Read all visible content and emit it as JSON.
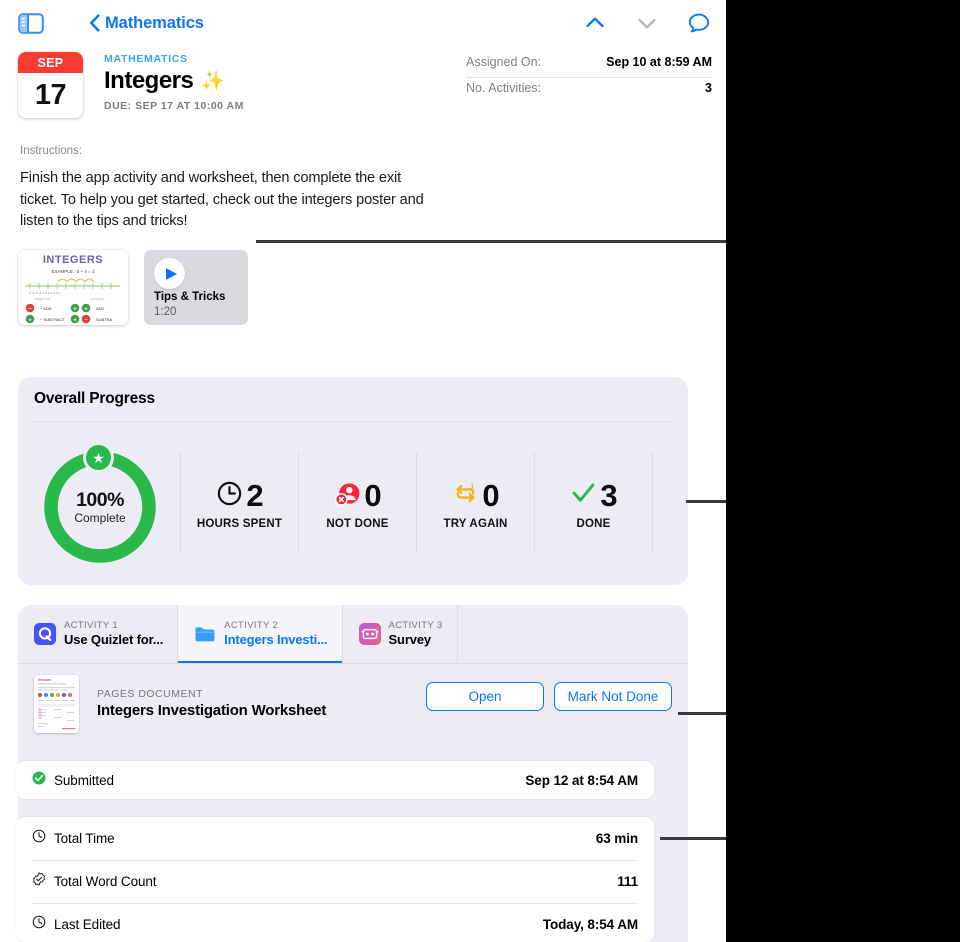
{
  "navbar": {
    "sidebar_toggle_icon": "sidebar-toggle-icon",
    "back_label": "Mathematics",
    "icons": [
      "chevron-up-icon",
      "chevron-down-icon",
      "comment-bubble-icon"
    ],
    "accent_color": "#0a76f6",
    "chevron_up_color": "#0a76f6",
    "chevron_down_color": "#b4b4bb"
  },
  "assignment": {
    "calendar": {
      "month": "SEP",
      "day": "17",
      "month_bg": "#fa3b32"
    },
    "course": "MATHEMATICS",
    "title": "Integers",
    "title_emoji": "✨",
    "due": "DUE: SEP 17 AT 10:00 AM"
  },
  "meta": {
    "rows": [
      {
        "key": "Assigned On:",
        "value": "Sep 10 at 8:59 AM"
      },
      {
        "key": "No. Activities:",
        "value": "3"
      }
    ]
  },
  "instructions": {
    "label": "Instructions:",
    "body": "Finish the app activity and worksheet, then complete the exit ticket. To help you get started, check out the integers poster and listen to the tips and tricks!"
  },
  "attachments": [
    {
      "kind": "image-poster",
      "icon": "integers-poster-thumbnail",
      "heading": "INTEGERS",
      "subheading": "EXAMPLE: -3 + 4 = 1",
      "left_label": "negative",
      "right_label": "positive",
      "rules": [
        "- ADD",
        "+ ADD",
        "+ SUBTRACT",
        "- SUBTRACT"
      ]
    },
    {
      "kind": "audio",
      "icon": "play-icon",
      "title": "Tips & Tricks",
      "duration": "1:20"
    }
  ],
  "progress_card": {
    "title": "Overall Progress",
    "background": "#edecf5",
    "ring": {
      "percent": 100,
      "percent_label": "100%",
      "sub_label": "Complete",
      "color": "#29b84a",
      "badge_icon": "star-badge-icon"
    },
    "stats": [
      {
        "icon": "clock-icon",
        "value": "2",
        "label": "HOURS SPENT",
        "icon_color": "#111111"
      },
      {
        "icon": "person-x-icon",
        "value": "0",
        "label": "NOT DONE",
        "icon_color": "#f5253a"
      },
      {
        "icon": "repeat-one-icon",
        "value": "0",
        "label": "TRY AGAIN",
        "icon_color": "#f8b219"
      },
      {
        "icon": "checkmark-icon",
        "value": "3",
        "label": "DONE",
        "icon_color": "#29b84a"
      }
    ]
  },
  "activity_card": {
    "tabs": [
      {
        "kicker": "ACTIVITY 1",
        "name": "Use Quizlet for...",
        "icon": "quizlet-app-icon",
        "active": false
      },
      {
        "kicker": "ACTIVITY 2",
        "name": "Integers Investi...",
        "icon": "pages-folder-icon",
        "active": true
      },
      {
        "kicker": "ACTIVITY 3",
        "name": "Survey",
        "icon": "survey-app-icon",
        "active": false
      }
    ],
    "document": {
      "thumbnail_icon": "pages-document-thumbnail",
      "kicker": "PAGES DOCUMENT",
      "name": "Integers Investigation Worksheet",
      "buttons": [
        {
          "label": "Open",
          "style": "outline-blue"
        },
        {
          "label": "Mark Not Done",
          "style": "outline-blue"
        }
      ]
    },
    "submitted_row": {
      "icon": "check-circle-icon",
      "icon_color": "#29b84a",
      "label": "Submitted",
      "value": "Sep 12 at 8:54 AM"
    },
    "detail_rows": [
      {
        "icon": "clock-icon",
        "label": "Total Time",
        "value": "63 min"
      },
      {
        "icon": "seal-check-icon",
        "label": "Total Word Count",
        "value": "111"
      },
      {
        "icon": "clock-icon",
        "label": "Last Edited",
        "value": "Today, 8:54 AM"
      }
    ]
  },
  "annotations": {
    "callout_color": "#3a3a3a",
    "callouts": [
      {
        "target": "attachments-row"
      },
      {
        "target": "progress-stats"
      },
      {
        "target": "mark-not-done-button"
      },
      {
        "target": "total-time-value"
      }
    ]
  }
}
